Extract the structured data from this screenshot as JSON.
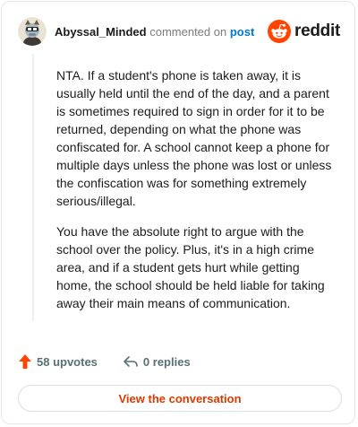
{
  "comment": {
    "author": "Abyssal_Minded",
    "action_text": "commented on",
    "target_link": "post",
    "paragraphs": [
      "NTA. If a student's phone is taken away, it is usually held until the end of the day, and a parent is sometimes required to sign in order for it to be returned, depending on what the phone was confiscated for. A school cannot keep a phone for multiple days unless the phone was lost or unless the confiscation was for something extremely serious/illegal.",
      "You have the absolute right to argue with the school over the policy. Plus, it's in a high crime area, and if a student gets hurt while getting home, the school should be held liable for taking away their main means of communication."
    ]
  },
  "brand": {
    "name": "reddit",
    "icon": "reddit-alien-icon",
    "color": "#ff4500"
  },
  "actions": {
    "upvotes": "58 upvotes",
    "replies": "0 replies"
  },
  "cta": {
    "label": "View the conversation"
  },
  "colors": {
    "accent": "#ff4500",
    "link": "#0079d3",
    "cta_text": "#d93a00"
  }
}
